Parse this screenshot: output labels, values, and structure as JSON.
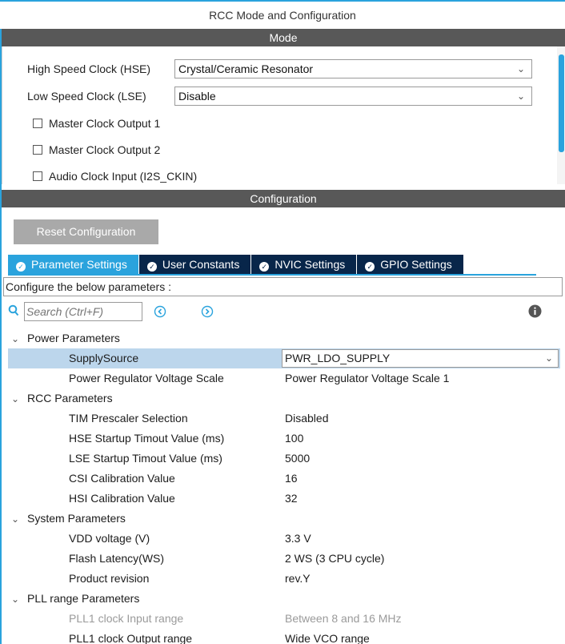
{
  "window": {
    "title": "RCC Mode and Configuration"
  },
  "mode": {
    "header": "Mode",
    "hse": {
      "label": "High Speed Clock (HSE)",
      "value": "Crystal/Ceramic Resonator"
    },
    "lse": {
      "label": "Low Speed Clock (LSE)",
      "value": "Disable"
    },
    "checkboxes": [
      {
        "label": "Master Clock Output 1",
        "checked": false
      },
      {
        "label": "Master Clock Output 2",
        "checked": false
      },
      {
        "label": "Audio Clock Input (I2S_CKIN)",
        "checked": false
      }
    ]
  },
  "configuration": {
    "header": "Configuration",
    "reset_label": "Reset Configuration",
    "tabs": [
      {
        "label": "Parameter Settings",
        "active": true
      },
      {
        "label": "User Constants",
        "active": false
      },
      {
        "label": "NVIC Settings",
        "active": false
      },
      {
        "label": "GPIO Settings",
        "active": false
      }
    ],
    "hint": "Configure the below parameters :",
    "search_placeholder": "Search (Ctrl+F)"
  },
  "tree": {
    "groups": [
      {
        "label": "Power Parameters",
        "params": [
          {
            "name": "SupplySource",
            "value": "PWR_LDO_SUPPLY"
          },
          {
            "name": "Power Regulator Voltage Scale",
            "value": "Power Regulator Voltage Scale 1"
          }
        ]
      },
      {
        "label": "RCC Parameters",
        "params": [
          {
            "name": "TIM Prescaler Selection",
            "value": "Disabled"
          },
          {
            "name": "HSE Startup Timout Value (ms)",
            "value": "100"
          },
          {
            "name": "LSE Startup Timout Value (ms)",
            "value": "5000"
          },
          {
            "name": "CSI Calibration Value",
            "value": "16"
          },
          {
            "name": "HSI Calibration Value",
            "value": "32"
          }
        ]
      },
      {
        "label": "System Parameters",
        "params": [
          {
            "name": "VDD voltage (V)",
            "value": "3.3 V"
          },
          {
            "name": "Flash Latency(WS)",
            "value": "2 WS (3 CPU cycle)"
          },
          {
            "name": "Product revision",
            "value": "rev.Y"
          }
        ]
      },
      {
        "label": "PLL range Parameters",
        "params": [
          {
            "name": "PLL1 clock Input range",
            "value": "Between 8 and 16 MHz"
          },
          {
            "name": "PLL1 clock Output range",
            "value": "Wide VCO range"
          }
        ]
      }
    ]
  },
  "colors": {
    "accent": "#2aa3dd",
    "tab_inactive": "#08264a",
    "section_header": "#585858",
    "selected_row": "#bcd6ec"
  }
}
